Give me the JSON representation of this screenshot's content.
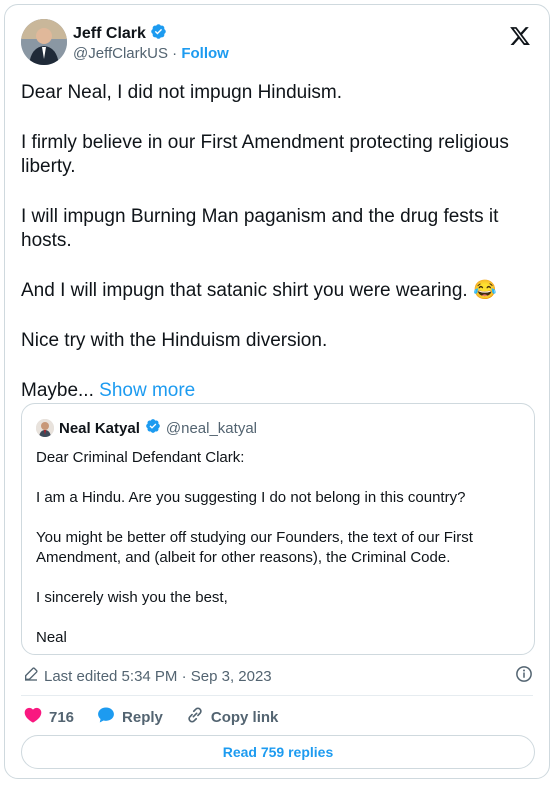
{
  "author": {
    "name": "Jeff Clark",
    "handle": "@JeffClarkUS",
    "separator": "·",
    "follow_label": "Follow"
  },
  "tweet": {
    "paragraphs": [
      "Dear Neal, I did not impugn Hinduism.",
      "I firmly believe in our First Amendment protecting religious liberty.",
      "I will impugn Burning Man paganism and the drug fests it hosts.",
      "And I will impugn that satanic shirt you were wearing. 😂",
      "Nice try with the Hinduism diversion."
    ],
    "truncated_text": "Maybe...",
    "show_more_label": "Show more"
  },
  "quote": {
    "name": "Neal Katyal",
    "handle": "@neal_katyal",
    "paragraphs": [
      "Dear Criminal Defendant Clark:",
      "I am a Hindu. Are you suggesting I do not belong in this country?",
      "You might be better off studying our Founders, the text of our First Amendment, and (albeit for other reasons), the Criminal Code.",
      "I sincerely wish you the best,",
      "Neal"
    ]
  },
  "meta": {
    "edited_label": "Last edited 5:34 PM · Sep 3, 2023"
  },
  "actions": {
    "likes": "716",
    "reply_label": "Reply",
    "copy_link_label": "Copy link"
  },
  "read_replies_label": "Read 759 replies",
  "colors": {
    "accent": "#1d9bf0",
    "like": "#f91880",
    "verified": "#1d9bf0",
    "muted": "#536471"
  }
}
